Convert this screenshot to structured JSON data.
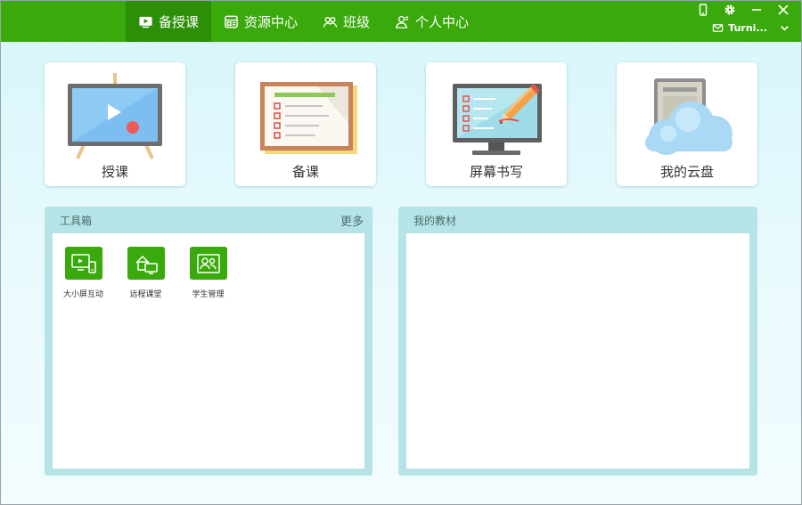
{
  "nav": {
    "items": [
      {
        "label": "备授课",
        "icon": "lesson-play-icon",
        "active": true
      },
      {
        "label": "资源中心",
        "icon": "resource-icon",
        "active": false
      },
      {
        "label": "班级",
        "icon": "class-icon",
        "active": false
      },
      {
        "label": "个人中心",
        "icon": "person-icon",
        "active": false
      }
    ]
  },
  "window": {
    "user_name": "Turni...",
    "icons": [
      "phone-icon",
      "gear-icon",
      "minimize-icon",
      "close-icon",
      "mail-icon",
      "chevron-down-icon"
    ]
  },
  "cards": [
    {
      "label": "授课",
      "icon": "teaching-board-icon"
    },
    {
      "label": "备课",
      "icon": "lesson-plan-icon"
    },
    {
      "label": "屏幕书写",
      "icon": "screen-write-icon"
    },
    {
      "label": "我的云盘",
      "icon": "cloud-drive-icon"
    }
  ],
  "toolbox": {
    "title": "工具箱",
    "more": "更多",
    "tools": [
      {
        "label": "大小屏互动",
        "icon": "screen-interact-icon"
      },
      {
        "label": "远程课堂",
        "icon": "remote-class-icon"
      },
      {
        "label": "学生管理",
        "icon": "student-manage-icon"
      }
    ]
  },
  "textbooks": {
    "title": "我的教材"
  },
  "colors": {
    "brand_green": "#3aa90c",
    "active_green": "#2c8f07",
    "panel_teal": "#b6e4e6",
    "background": "#e2f8fc"
  }
}
